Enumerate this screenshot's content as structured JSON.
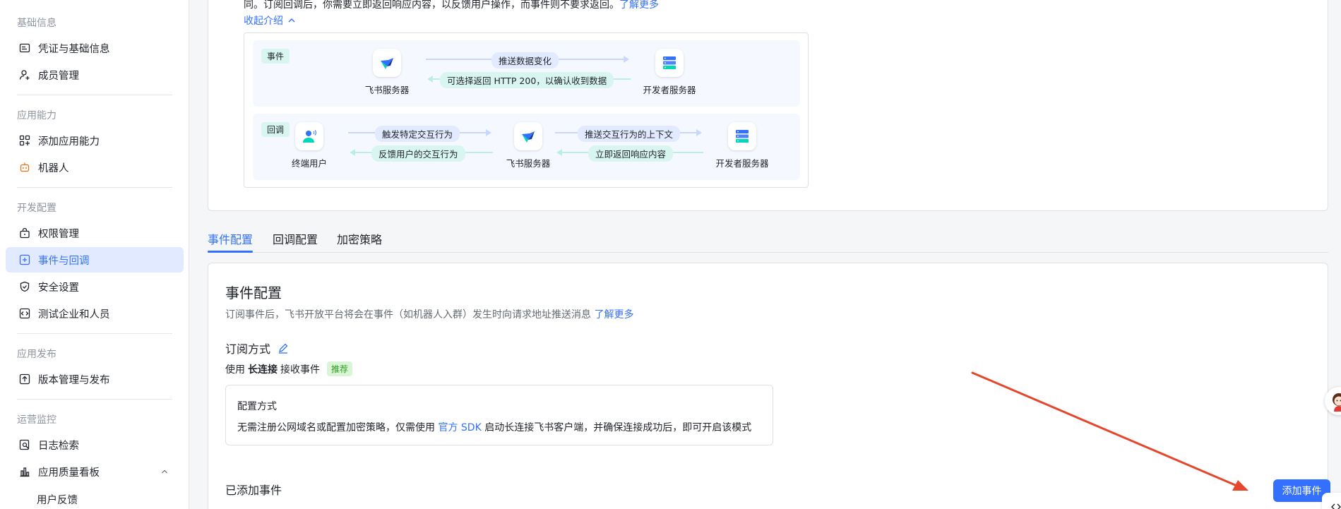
{
  "sidebar": {
    "groups": {
      "basic": "基础信息",
      "capability": "应用能力",
      "dev": "开发配置",
      "publish": "应用发布",
      "ops": "运营监控"
    },
    "items": {
      "credentials": "凭证与基础信息",
      "members": "成员管理",
      "add_capability": "添加应用能力",
      "bot": "机器人",
      "permissions": "权限管理",
      "events": "事件与回调",
      "security": "安全设置",
      "test_org": "测试企业和人员",
      "versions": "版本管理与发布",
      "logs": "日志检索",
      "quality": "应用质量看板",
      "feedback": "用户反馈"
    }
  },
  "intro": {
    "text": "同。订阅回调后，你需要立即返回响应内容，以反馈用户操作，而事件则不要求返回。",
    "learn_more": "了解更多",
    "collapse": "收起介绍"
  },
  "diagram": {
    "event_tag": "事件",
    "callback_tag": "回调",
    "feishu_server": "飞书服务器",
    "dev_server": "开发者服务器",
    "end_user": "终端用户",
    "push_data": "推送数据变化",
    "return_200": "可选择返回 HTTP 200，以确认收到数据",
    "trigger": "触发特定交互行为",
    "feedback": "反馈用户的交互行为",
    "push_context": "推送交互行为的上下文",
    "return_now": "立即返回响应内容"
  },
  "tabs": {
    "event_config": "事件配置",
    "callback_config": "回调配置",
    "encrypt": "加密策略"
  },
  "event_config": {
    "title": "事件配置",
    "desc": "订阅事件后，飞书开放平台将会在事件（如机器人入群）发生时向请求地址推送消息",
    "learn_more": "了解更多",
    "sub_method": "订阅方式",
    "use_prefix": "使用",
    "use_bold": "长连接",
    "use_suffix": "接收事件",
    "recommended": "推荐",
    "config_title": "配置方式",
    "config_text_1": "无需注册公网域名或配置加密策略，仅需使用",
    "config_sdk": "官方 SDK",
    "config_text_2": "启动长连接飞书客户端，并确保连接成功后，即可开启该模式",
    "added_events": "已添加事件",
    "add_button": "添加事件"
  },
  "colors": {
    "accent": "#3370ff",
    "annotation_arrow": "#e5462c",
    "active_bg": "#e1eaff"
  }
}
